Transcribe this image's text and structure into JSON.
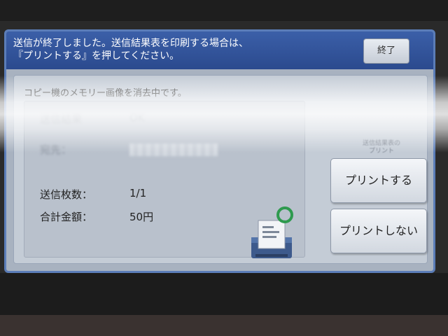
{
  "header": {
    "message_line1": "送信が終了しました。送信結果表を印刷する場合は、",
    "message_line2": "『プリントする』を押してください。",
    "close_label": "終了"
  },
  "status": "コピー機のメモリー画像を消去中です。",
  "result": {
    "result_label": "送信結果",
    "result_value": "OK",
    "dest_label": "宛先：",
    "pages_label": "送信枚数：",
    "pages_value": "1/1",
    "total_label": "合計金額：",
    "total_value": "50円"
  },
  "side": {
    "caption_line1": "送信結果表の",
    "caption_line2": "プリント",
    "print_label": "プリントする",
    "noprint_label": "プリントしない"
  },
  "colors": {
    "header": "#2b4a8e",
    "panel": "#c4ccd6",
    "check_ring": "#2e9a4e"
  },
  "icons": [
    "printer-icon",
    "check-circle-icon"
  ]
}
